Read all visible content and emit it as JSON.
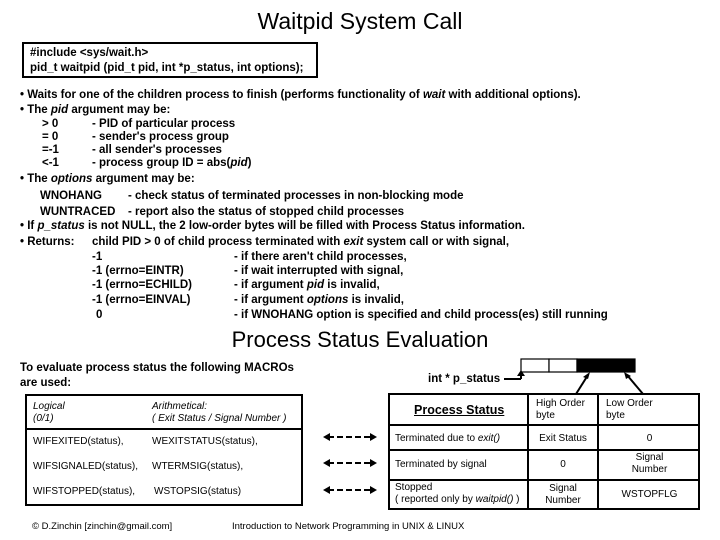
{
  "slide": {
    "title": "Waitpid System Call",
    "code": {
      "line1": "#include <sys/wait.h>",
      "line2": "pid_t waitpid (pid_t pid, int *p_status, int options);"
    },
    "bullets": {
      "b1_pre": "• Waits for one of the children process to finish (performs functionality of ",
      "b1_it": "wait",
      "b1_post": " with additional options).",
      "b2_pre": "• The ",
      "b2_it": "pid",
      "b2_post": " argument may be:",
      "pid_values": [
        {
          "value": "> 0",
          "desc": "- PID of particular process"
        },
        {
          "value": "= 0",
          "desc": "- sender's process group"
        },
        {
          "value": "=-1",
          "desc": "- all sender's processes"
        },
        {
          "value": "<-1",
          "desc": "- process group ID = abs(",
          "desc_it": "pid",
          "desc_post": ")"
        }
      ],
      "b3_pre": "• The ",
      "b3_it": "options",
      "b3_post": " argument may be:",
      "options": [
        {
          "name": "WNOHANG",
          "desc": "- check status of terminated processes in non-blocking mode"
        },
        {
          "name": "WUNTRACED",
          "desc": "- report also the status of stopped child processes"
        }
      ],
      "b4_pre": "• If ",
      "b4_it": "p_status",
      "b4_post": " is not NULL, the 2 low-order bytes will be filled with Process Status information.",
      "b5_label": "• Returns:",
      "b5_pre": "child PID > 0 of child process terminated with ",
      "b5_it": "exit",
      "b5_post": " system call or with signal,",
      "returns": [
        {
          "value": "-1",
          "desc": "- if there aren't child processes,"
        },
        {
          "value": "-1 (errno=EINTR)",
          "desc": "- if wait interrupted with signal,"
        },
        {
          "value": "-1 (errno=ECHILD)",
          "desc": "- if argument ",
          "desc_it": "pid",
          "desc_post": " is invalid,"
        },
        {
          "value": "-1 (errno=EINVAL)",
          "desc": "- if argument  ",
          "desc_it": "options",
          "desc_post": " is invalid,"
        },
        {
          "value": "0",
          "desc": "- if  WNOHANG option is specified and child process(es) still running"
        }
      ]
    },
    "section2": {
      "title": "Process Status Evaluation",
      "intro_line1": "To evaluate process status the following MACROs",
      "intro_line2": "are used:",
      "p_status_label": "int * p_status",
      "macro_table": {
        "head_logical_1": "Logical",
        "head_logical_2": "(0/1)",
        "head_arith_1": "Arithmetical:",
        "head_arith_2": "( Exit Status  /  Signal Number )",
        "rows": [
          {
            "logical": "WIFEXITED(status),",
            "arith": "WEXITSTATUS(status),"
          },
          {
            "logical": "WIFSIGNALED(status),",
            "arith": "WTERMSIG(status),"
          },
          {
            "logical": "WIFSTOPPED(status),",
            "arith": "WSTOPSIG(status)"
          }
        ]
      },
      "status_table": {
        "head_status": "Process Status",
        "head_high_1": "High Order",
        "head_high_2": "byte",
        "head_low_1": "Low Order",
        "head_low_2": "byte",
        "rows": [
          {
            "status": "Terminated due to ",
            "status_it": "exit()",
            "high": "Exit Status",
            "low": "0"
          },
          {
            "status": "Terminated by signal",
            "high": "0",
            "low_1": "Signal",
            "low_2": "Number"
          },
          {
            "status_1": "Stopped",
            "status_2": "( reported only by ",
            "status_it": "waitpid()",
            "status_post": " )",
            "high_1": "Signal",
            "high_2": "Number",
            "low": "WSTOPFLG"
          }
        ]
      }
    },
    "footer": {
      "author": "© D.Zinchin [zinchin@gmail.com]",
      "course": "Introduction to Network Programming in UNIX & LINUX"
    }
  }
}
